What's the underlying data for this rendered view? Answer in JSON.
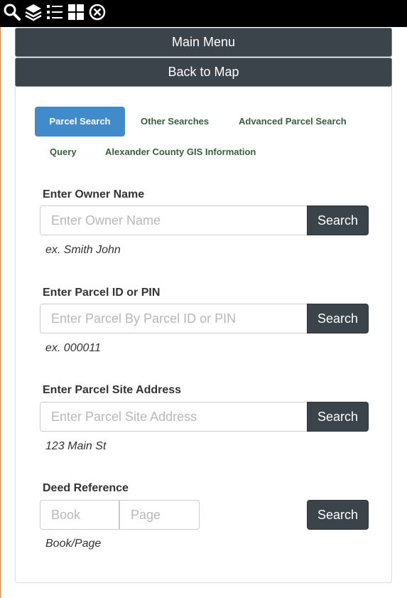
{
  "toolbar": {
    "icons": [
      "search-icon",
      "layers-icon",
      "list-icon",
      "grid-icon",
      "close-circle-icon"
    ]
  },
  "menu": {
    "main_label": "Main Menu",
    "back_label": "Back to Map"
  },
  "tabs": [
    {
      "label": "Parcel Search",
      "active": true
    },
    {
      "label": "Other Searches",
      "active": false
    },
    {
      "label": "Advanced Parcel Search",
      "active": false
    },
    {
      "label": "Query",
      "active": false
    },
    {
      "label": "Alexander County GIS Information",
      "active": false
    }
  ],
  "owner": {
    "label": "Enter Owner Name",
    "placeholder": "Enter Owner Name",
    "button": "Search",
    "example": "ex. Smith John"
  },
  "parcel": {
    "label": "Enter Parcel ID or PIN",
    "placeholder": "Enter Parcel By Parcel ID or PIN",
    "button": "Search",
    "example": "ex. 000011"
  },
  "address": {
    "label": "Enter Parcel Site Address",
    "placeholder": "Enter Parcel Site Address",
    "button": "Search",
    "example": "123 Main St"
  },
  "deed": {
    "label": "Deed Reference",
    "book_placeholder": "Book",
    "page_placeholder": "Page",
    "button": "Search",
    "example": "Book/Page"
  },
  "colors": {
    "toolbar": "#000000",
    "menu_bar": "#3b444b",
    "tab_active": "#428bca",
    "tab_text": "#365f3f"
  }
}
